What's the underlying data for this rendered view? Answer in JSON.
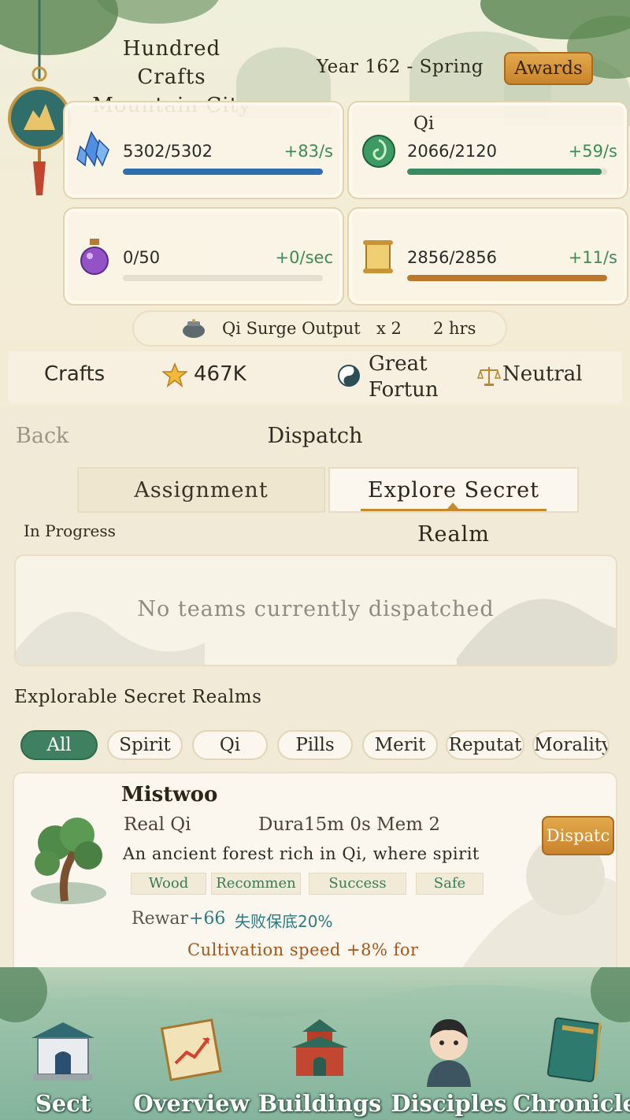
{
  "header": {
    "city_line1": "Hundred Crafts",
    "city_line2": "Mountain City",
    "year": "Year 162 - Spring",
    "awards_label": "Awards"
  },
  "resources": [
    {
      "icon": "spirit-crystal-icon",
      "title": "",
      "value": "5302/5302",
      "rate": "+83/s",
      "fill": 1.0,
      "color": "#2f6fb0"
    },
    {
      "icon": "qi-jade-icon",
      "title": "Qi",
      "value": "2066/2120",
      "rate": "+59/s",
      "fill": 0.974,
      "color": "#3a8a63"
    },
    {
      "icon": "pill-bottle-icon",
      "title": "",
      "value": "0/50",
      "rate": "+0/sec",
      "fill": 0.0,
      "color": "#8e5bb5"
    },
    {
      "icon": "scroll-icon",
      "title": "",
      "value": "2856/2856",
      "rate": "+11/s",
      "fill": 1.0,
      "color": "#b9782a"
    }
  ],
  "surge": {
    "text": "Qi Surge Output",
    "multiplier": "x 2",
    "duration": "2 hrs"
  },
  "stats": {
    "crafts_label": "Crafts",
    "score": "467K",
    "fortune": "Great Fortun",
    "morality": "Neutral"
  },
  "dispatch": {
    "back_label": "Back",
    "title": "Dispatch",
    "tabs": [
      "Assignment",
      "Explore Secret Realm"
    ],
    "in_progress_label": "In Progress",
    "empty_text": "No teams currently dispatched",
    "explorable_label": "Explorable Secret Realms",
    "filters": [
      "All",
      "Spirit",
      "Qi",
      "Pills",
      "Merit",
      "Reputat",
      "Morality"
    ],
    "realm": {
      "name": "Mistwoo",
      "real": "Real Qi",
      "duration": "Dura15m 0s Mem 2",
      "description": "An ancient forest rich in Qi, where spirit",
      "tags": [
        "Wood",
        "Recommen",
        "Success",
        "Safe"
      ],
      "reward_label": "Rewar",
      "reward_value": "+66",
      "reward_fail": "失败保底20%",
      "cultivation": "Cultivation speed +8% for",
      "dispatch_label": "Dispatc"
    }
  },
  "nav": [
    "Sect",
    "Overview",
    "Buildings",
    "Disciples",
    "Chronicle"
  ]
}
